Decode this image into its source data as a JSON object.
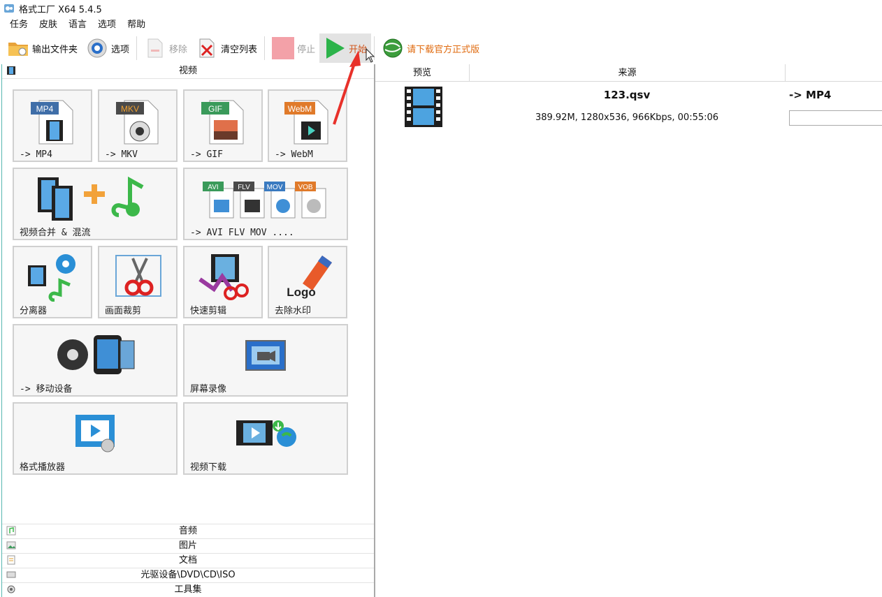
{
  "window": {
    "title": "格式工厂 X64 5.4.5"
  },
  "menu": [
    "任务",
    "皮肤",
    "语言",
    "选项",
    "帮助"
  ],
  "toolbar": {
    "output_folder": "输出文件夹",
    "options": "选项",
    "remove": "移除",
    "clear_list": "清空列表",
    "stop": "停止",
    "start": "开始",
    "download_official": "请下载官方正式版"
  },
  "categories": {
    "video": "视频",
    "audio": "音频",
    "image": "图片",
    "document": "文档",
    "disc": "光驱设备\\DVD\\CD\\ISO",
    "tools": "工具集"
  },
  "video_tiles": {
    "mp4": {
      "badge": "MP4",
      "label": "-> MP4"
    },
    "mkv": {
      "badge": "MKV",
      "label": "-> MKV"
    },
    "gif": {
      "badge": "GIF",
      "label": "-> GIF"
    },
    "webm": {
      "badge": "WebM",
      "label": "-> WebM"
    },
    "merge": {
      "label": "视频合并 & 混流"
    },
    "other_formats": {
      "badges": [
        "AVI",
        "FLV",
        "MOV",
        "VOB"
      ],
      "label": "-> AVI FLV MOV ...."
    },
    "splitter": {
      "label": "分离器"
    },
    "crop": {
      "label": "画面裁剪"
    },
    "quick_cut": {
      "label": "快速剪辑"
    },
    "remove_watermark": {
      "icon_text": "Logo",
      "label": "去除水印"
    },
    "mobile": {
      "label": "-> 移动设备"
    },
    "screen_record": {
      "label": "屏幕录像"
    },
    "player": {
      "label": "格式播放器"
    },
    "video_download": {
      "label": "视频下载"
    }
  },
  "task_list": {
    "columns": [
      "预览",
      "来源"
    ],
    "items": [
      {
        "filename": "123.qsv",
        "info": "389.92M, 1280x536, 966Kbps, 00:55:06",
        "target": "-> MP4"
      }
    ]
  }
}
